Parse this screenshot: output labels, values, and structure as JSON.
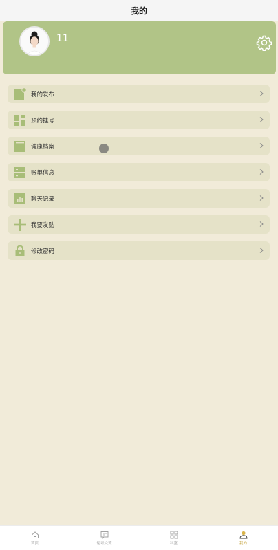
{
  "header": {
    "title": "我的"
  },
  "profile": {
    "username": "11"
  },
  "menu": {
    "items": [
      {
        "label": "我的发布",
        "icon": "note-edit-icon"
      },
      {
        "label": "预约挂号",
        "icon": "dashboard-grid-icon"
      },
      {
        "label": "健康档案",
        "icon": "folder-icon"
      },
      {
        "label": "账单信息",
        "icon": "list-icon"
      },
      {
        "label": "聊天记录",
        "icon": "bar-chart-icon"
      },
      {
        "label": "我要发贴",
        "icon": "plus-icon"
      },
      {
        "label": "修改密码",
        "icon": "lock-icon"
      }
    ]
  },
  "tabbar": {
    "items": [
      {
        "label": "首页",
        "icon": "home-icon"
      },
      {
        "label": "论坛交流",
        "icon": "chat-icon"
      },
      {
        "label": "科室",
        "icon": "grid-icon"
      },
      {
        "label": "我的",
        "icon": "user-icon",
        "active": true
      }
    ]
  },
  "colors": {
    "profile_bg": "#b1c487",
    "page_bg": "#f1ebd9",
    "menu_item_bg": "#e5e2c8",
    "icon_green": "#a8bd78",
    "tab_active": "#c4a23b"
  }
}
